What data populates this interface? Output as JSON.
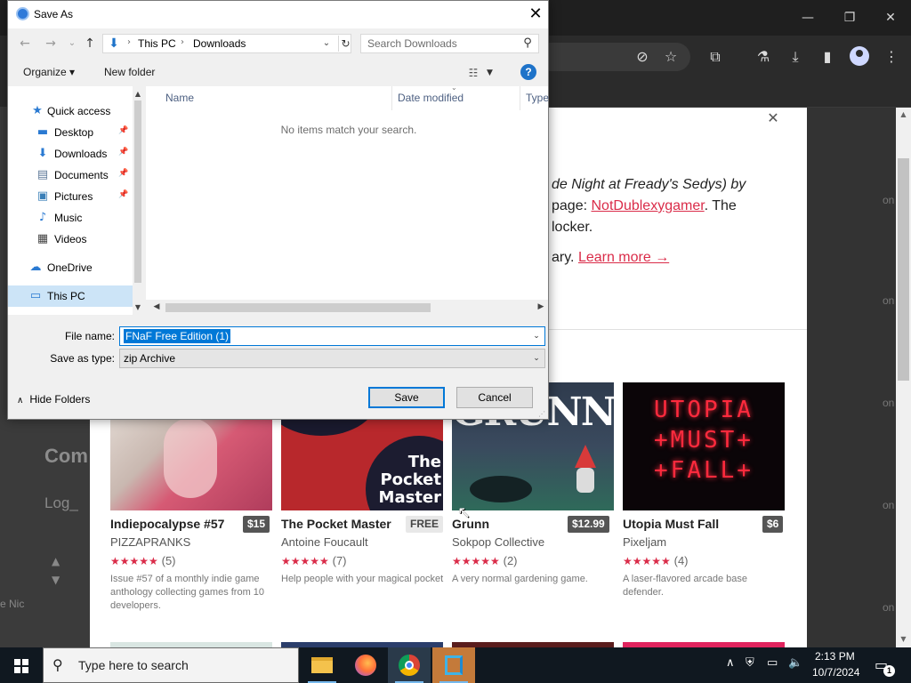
{
  "browser": {
    "icons": [
      "minimize-icon",
      "restore-icon",
      "close-icon",
      "eye-off-icon",
      "star-icon",
      "extensions-icon",
      "flask-icon",
      "download-icon",
      "sidepanel-icon",
      "profile-icon",
      "menu-icon"
    ]
  },
  "itch_modal": {
    "line1": "de Night at Fready's Sedys) by",
    "line2_prefix": "page: ",
    "line2_link": "NotDublexygamer",
    "line2_suffix": ". The",
    "line3": "locker.",
    "line4_prefix": "ary. ",
    "line4_link": "Learn more →"
  },
  "games": [
    {
      "title": "Indiepocalypse #57",
      "price": "$15",
      "author": "PIZZAPRANKS",
      "rating": "(5)",
      "desc": "Issue #57 of a monthly indie game anthology collecting games from 10 developers."
    },
    {
      "title": "The Pocket Master",
      "price": "FREE",
      "author": "Antoine Foucault",
      "rating": "(7)",
      "desc": "Help people with your magical pocket"
    },
    {
      "title": "Grunn",
      "price": "$12.99",
      "author": "Sokpop Collective",
      "rating": "(2)",
      "desc": "A very normal gardening game."
    },
    {
      "title": "Utopia Must Fall",
      "price": "$6",
      "author": "Pixeljam",
      "rating": "(4)",
      "desc": "A laser-flavored arcade base defender."
    }
  ],
  "thumb_text": {
    "pocket": "The Pocket Master",
    "grunn": "GRUNN",
    "utopia": [
      "UTOPIA",
      "+MUST+",
      "+FALL+"
    ]
  },
  "background_deco": {
    "left_big": "Com",
    "left_small": "Log_",
    "side_on": [
      "on",
      "on",
      "on",
      "on",
      "on",
      "on"
    ],
    "left_nic": "e Nic"
  },
  "dialog": {
    "title": "Save As",
    "breadcrumb": [
      "This PC",
      "Downloads"
    ],
    "search_placeholder": "Search Downloads",
    "organize": "Organize ▾",
    "new_folder": "New folder",
    "help": "?",
    "nav_items": [
      {
        "label": "Quick access",
        "icon": "star-icon"
      },
      {
        "label": "Desktop",
        "icon": "desktop-icon",
        "pinned": true
      },
      {
        "label": "Downloads",
        "icon": "download-icon",
        "pinned": true
      },
      {
        "label": "Documents",
        "icon": "document-icon",
        "pinned": true
      },
      {
        "label": "Pictures",
        "icon": "pictures-icon",
        "pinned": true
      },
      {
        "label": "Music",
        "icon": "music-icon"
      },
      {
        "label": "Videos",
        "icon": "videos-icon"
      },
      {
        "label": "OneDrive",
        "icon": "cloud-icon"
      },
      {
        "label": "This PC",
        "icon": "computer-icon",
        "selected": true
      }
    ],
    "columns": [
      "Name",
      "Date modified",
      "Type"
    ],
    "empty_message": "No items match your search.",
    "file_name_label": "File name:",
    "file_name_value": "FNaF Free Edition (1)",
    "save_type_label": "Save as type:",
    "save_type_value": "zip Archive",
    "hide_folders": "Hide Folders",
    "save_button": "Save",
    "cancel_button": "Cancel"
  },
  "taskbar": {
    "search_text": "Type here to search",
    "apps": [
      "file-explorer-icon",
      "firefox-icon",
      "chrome-icon",
      "vscode-icon"
    ],
    "time": "2:13 PM",
    "date": "10/7/2024",
    "notification_count": "1"
  },
  "colors": {
    "accent": "#0078d7",
    "itch_red": "#da2c49",
    "taskbar": "#101820"
  }
}
